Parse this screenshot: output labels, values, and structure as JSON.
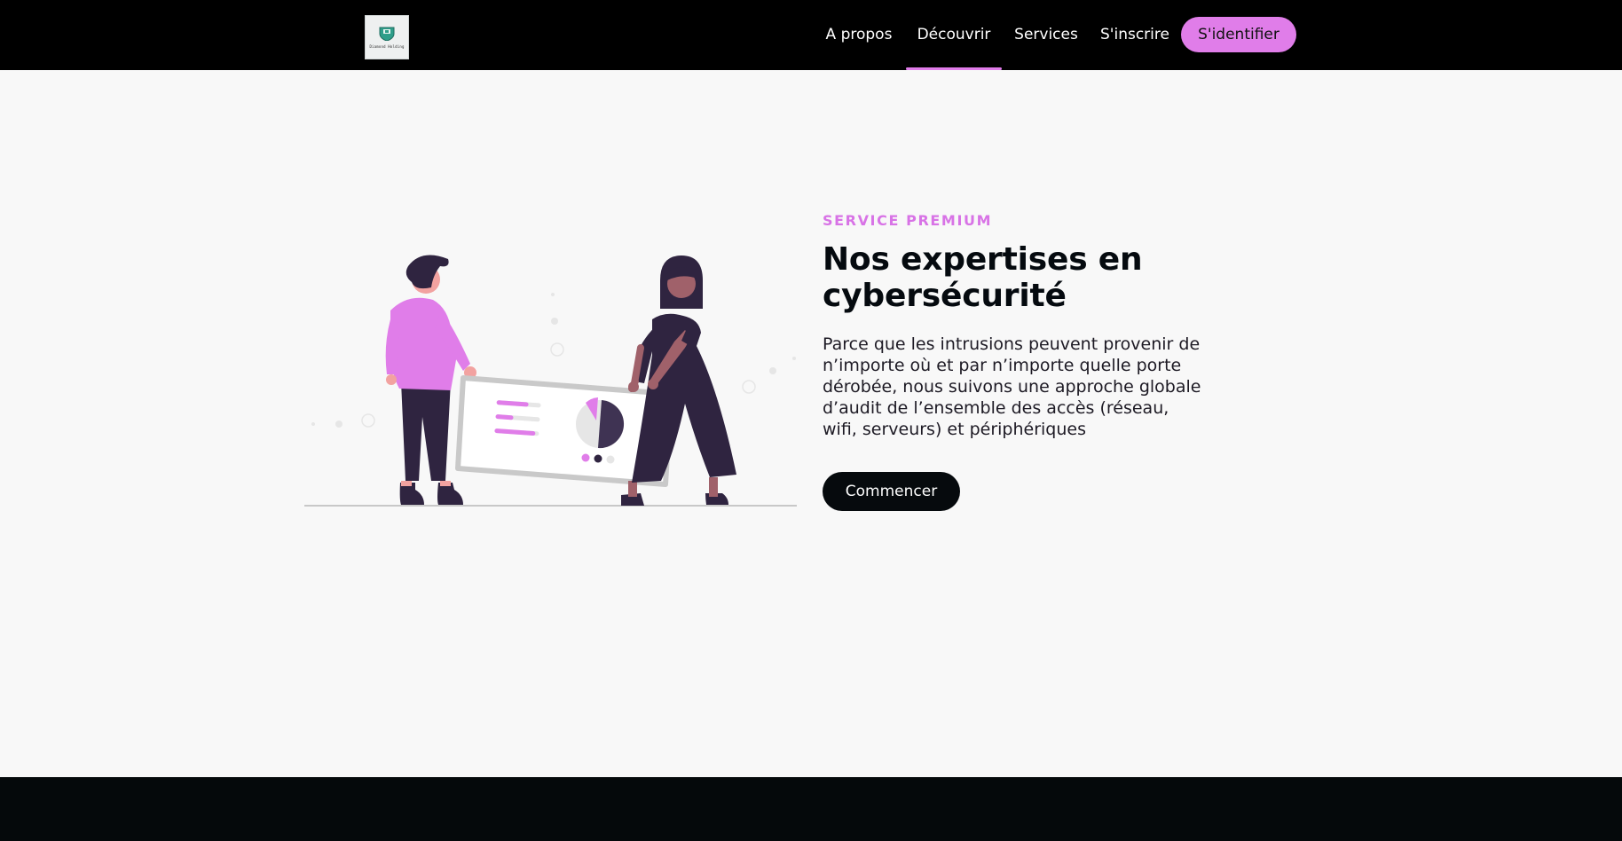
{
  "brand": {
    "logo_text": "Diamond Holding",
    "logo_icon": "shield-icon"
  },
  "nav": {
    "items": [
      {
        "label": "A propos"
      },
      {
        "label": "Découvrir"
      },
      {
        "label": "Services"
      },
      {
        "label": "S'inscrire"
      }
    ],
    "active": "Découvrir",
    "login_label": "S'identifier"
  },
  "hero": {
    "eyebrow": "SERVICE PREMIUM",
    "title": "Nos expertises en cybersécurité",
    "description": "Parce que les intrusions peuvent provenir de n’importe où et par n’importe quelle porte dérobée, nous suivons une approche globale d’audit de l’ensemble des accès (réseau, wifi, serveurs) et périphériques",
    "cta_label": "Commencer",
    "illustration": "people-holding-dashboard-illustration"
  },
  "colors": {
    "accent": "#e07de9",
    "navbar": "#000000",
    "background": "#f8f8f8",
    "dark": "#2f2440",
    "footer": "#05090b"
  }
}
